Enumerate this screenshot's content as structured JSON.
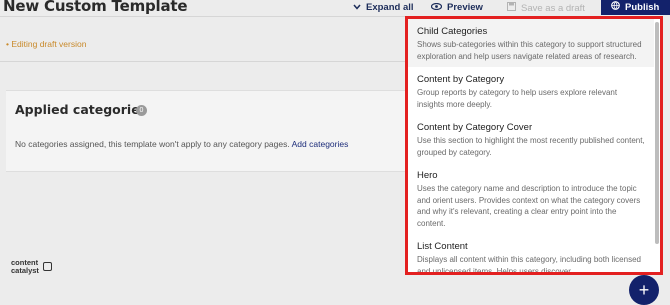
{
  "header": {
    "title": "New Custom Template",
    "expand_label": "Expand all",
    "preview_label": "Preview",
    "save_draft_label": "Save as a draft",
    "publish_label": "Publish"
  },
  "status": {
    "draft_note": "• Editing draft version"
  },
  "applied": {
    "title": "Applied categories",
    "count": "0",
    "empty_text": "No categories assigned, this template won't apply to any category pages.",
    "add_link": "Add categories"
  },
  "logo": {
    "line1": "content",
    "line2": "catalyst"
  },
  "fab": {
    "label": "+"
  },
  "dropdown": {
    "items": [
      {
        "name": "Child Categories",
        "desc": "Shows sub-categories within this category to support structured exploration and help users navigate related areas of research."
      },
      {
        "name": "Content by Category",
        "desc": "Group reports by category to help users explore relevant insights more deeply."
      },
      {
        "name": "Content by Category Cover",
        "desc": "Use this section to highlight the most recently published content, grouped by category."
      },
      {
        "name": "Hero",
        "desc": "Uses the category name and description to introduce the topic and orient users. Provides context on what the category covers and why it's relevant, creating a clear entry point into the content."
      },
      {
        "name": "List Content",
        "desc": "Displays all content within this category, including both licensed and unlicensed items. Helps users discover"
      }
    ]
  },
  "colors": {
    "accent": "#13226b",
    "highlight_border": "#e32020",
    "draft": "#c98a2b"
  }
}
